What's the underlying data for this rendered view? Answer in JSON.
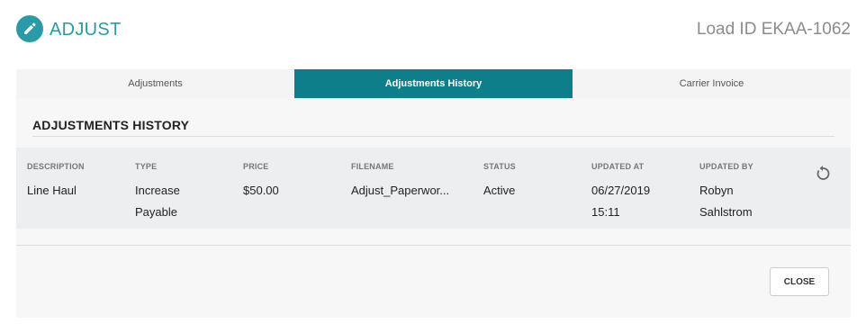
{
  "header": {
    "title": "ADJUST",
    "icon": "pencil-icon",
    "load_id": "Load ID EKAA-1062",
    "accent_color": "#2a9aa7"
  },
  "tabs": [
    {
      "label": "Adjustments",
      "active": false
    },
    {
      "label": "Adjustments History",
      "active": true
    },
    {
      "label": "Carrier Invoice",
      "active": false
    }
  ],
  "history": {
    "title": "ADJUSTMENTS HISTORY",
    "columns": [
      "DESCRIPTION",
      "TYPE",
      "PRICE",
      "FILENAME",
      "STATUS",
      "UPDATED AT",
      "UPDATED BY"
    ],
    "rows": [
      {
        "description": "Line Haul",
        "type": "Increase\nPayable",
        "price": "$50.00",
        "filename": "Adjust_Paperwor...",
        "status": "Active",
        "updated_at": "06/27/2019\n15:11",
        "updated_by": "Robyn\nSahlstrom",
        "action_icon": "undo-icon"
      }
    ]
  },
  "footer": {
    "close_label": "CLOSE"
  }
}
